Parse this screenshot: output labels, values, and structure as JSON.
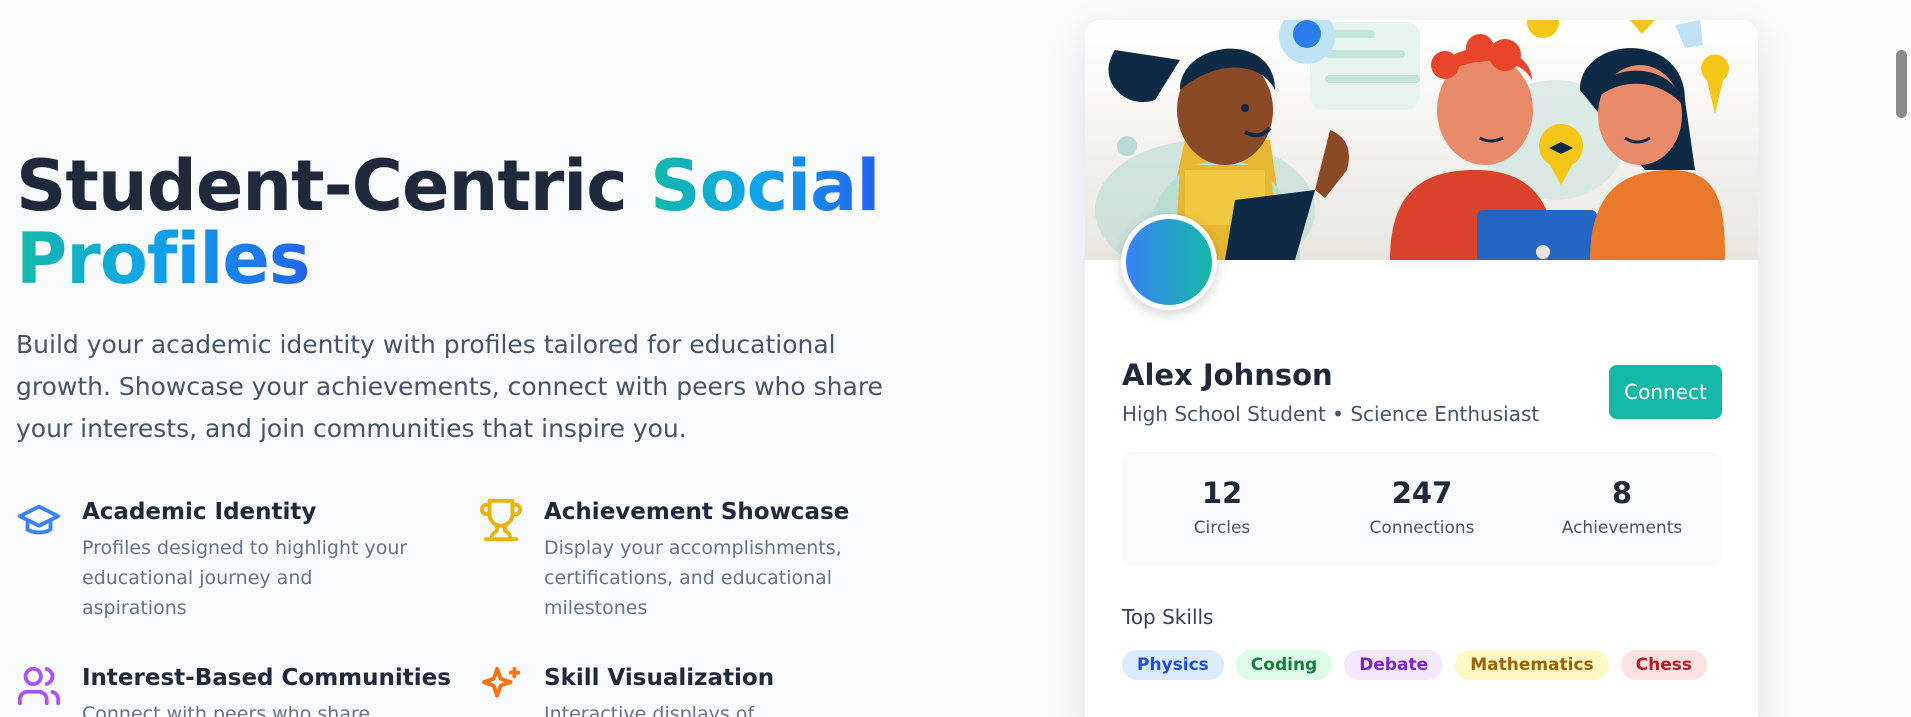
{
  "hero": {
    "title_plain": "Student-Centric ",
    "title_accent_1": "Social",
    "title_accent_2": "Profiles",
    "description": "Build your academic identity with profiles tailored for educational growth. Showcase your achievements, connect with peers who share your interests, and join communities that inspire you."
  },
  "features": [
    {
      "icon": "graduation-cap-icon",
      "title": "Academic Identity",
      "desc": "Profiles designed to highlight your educational journey and aspirations",
      "color": "#3b82f6"
    },
    {
      "icon": "trophy-icon",
      "title": "Achievement Showcase",
      "desc": "Display your accomplishments, certifications, and educational milestones",
      "color": "#eab308"
    },
    {
      "icon": "users-icon",
      "title": "Interest-Based Communities",
      "desc": "Connect with peers who share",
      "color": "#a855f7"
    },
    {
      "icon": "sparkles-icon",
      "title": "Skill Visualization",
      "desc": "Interactive displays of",
      "color": "#f97316"
    }
  ],
  "profile": {
    "name": "Alex Johnson",
    "role": "High School Student • Science Enthusiast",
    "connect_label": "Connect",
    "stats": [
      {
        "value": "12",
        "label": "Circles"
      },
      {
        "value": "247",
        "label": "Connections"
      },
      {
        "value": "8",
        "label": "Achievements"
      }
    ],
    "skills_title": "Top Skills",
    "skills": [
      {
        "label": "Physics",
        "bg": "#dbeafe",
        "fg": "#1d4ed8"
      },
      {
        "label": "Coding",
        "bg": "#dcfce7",
        "fg": "#15803d"
      },
      {
        "label": "Debate",
        "bg": "#f3e8ff",
        "fg": "#7e22ce"
      },
      {
        "label": "Mathematics",
        "bg": "#fef9c3",
        "fg": "#a16207"
      },
      {
        "label": "Chess",
        "bg": "#fee2e2",
        "fg": "#b91c1c"
      }
    ]
  },
  "colors": {
    "accent": "#14b8a6",
    "brand_blue": "#2563eb"
  }
}
